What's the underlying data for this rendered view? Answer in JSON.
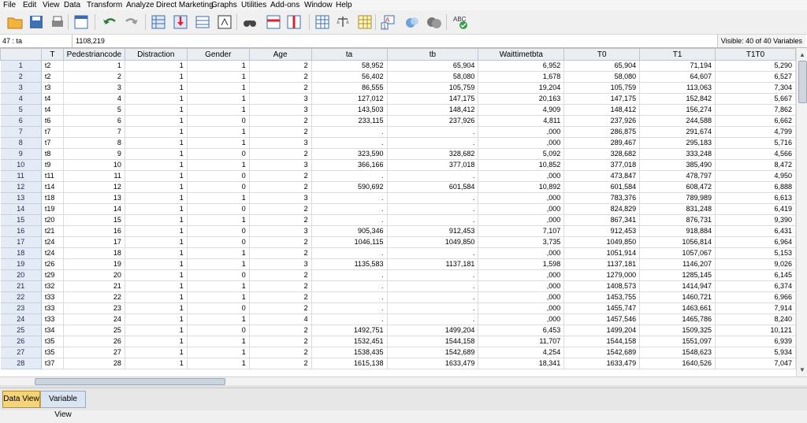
{
  "menu": [
    "File",
    "Edit",
    "View",
    "Data",
    "Transform",
    "Analyze",
    "Direct Marketing",
    "Graphs",
    "Utilities",
    "Add-ons",
    "Window",
    "Help"
  ],
  "toolbar_icons": [
    "open-folder-icon",
    "save-icon",
    "print-icon",
    "dialog-recall-icon",
    "undo-icon",
    "redo-icon",
    "goto-case-icon",
    "goto-variable-icon",
    "variables-icon",
    "run-descriptives-icon",
    "find-icon",
    "insert-cases-icon",
    "insert-variable-icon",
    "split-file-icon",
    "weight-cases-icon",
    "select-cases-icon",
    "value-labels-icon",
    "use-variable-sets-icon",
    "show-all-variables-icon",
    "spell-check-icon"
  ],
  "cell_editor": {
    "ref": "47 : ta",
    "value": "1108,219",
    "visible": "Visible: 40 of 40 Variables"
  },
  "columns": [
    "T",
    "Pedestriancode",
    "Distraction",
    "Gender",
    "Age",
    "ta",
    "tb",
    "Waittimetbta",
    "T0",
    "T1",
    "T1T0"
  ],
  "rows": [
    [
      "1",
      "t2",
      "1",
      "1",
      "1",
      "2",
      "58,952",
      "65,904",
      "6,952",
      "65,904",
      "71,194",
      "5,290"
    ],
    [
      "2",
      "t2",
      "2",
      "1",
      "1",
      "2",
      "56,402",
      "58,080",
      "1,678",
      "58,080",
      "64,607",
      "6,527"
    ],
    [
      "3",
      "t3",
      "3",
      "1",
      "1",
      "2",
      "86,555",
      "105,759",
      "19,204",
      "105,759",
      "113,063",
      "7,304"
    ],
    [
      "4",
      "t4",
      "4",
      "1",
      "1",
      "3",
      "127,012",
      "147,175",
      "20,163",
      "147,175",
      "152,842",
      "5,667"
    ],
    [
      "5",
      "t4",
      "5",
      "1",
      "1",
      "3",
      "143,503",
      "148,412",
      "4,909",
      "148,412",
      "156,274",
      "7,862"
    ],
    [
      "6",
      "t6",
      "6",
      "1",
      "0",
      "2",
      "233,115",
      "237,926",
      "4,811",
      "237,926",
      "244,588",
      "6,662"
    ],
    [
      "7",
      "t7",
      "7",
      "1",
      "1",
      "2",
      ".",
      ".",
      ",000",
      "286,875",
      "291,674",
      "4,799"
    ],
    [
      "8",
      "t7",
      "8",
      "1",
      "1",
      "3",
      ".",
      ".",
      ",000",
      "289,467",
      "295,183",
      "5,716"
    ],
    [
      "9",
      "t8",
      "9",
      "1",
      "0",
      "2",
      "323,590",
      "328,682",
      "5,092",
      "328,682",
      "333,248",
      "4,566"
    ],
    [
      "10",
      "t9",
      "10",
      "1",
      "1",
      "3",
      "366,166",
      "377,018",
      "10,852",
      "377,018",
      "385,490",
      "8,472"
    ],
    [
      "11",
      "t11",
      "11",
      "1",
      "0",
      "2",
      ".",
      ".",
      ",000",
      "473,847",
      "478,797",
      "4,950"
    ],
    [
      "12",
      "t14",
      "12",
      "1",
      "0",
      "2",
      "590,692",
      "601,584",
      "10,892",
      "601,584",
      "608,472",
      "6,888"
    ],
    [
      "13",
      "t18",
      "13",
      "1",
      "1",
      "3",
      ".",
      ".",
      ",000",
      "783,376",
      "789,989",
      "6,613"
    ],
    [
      "14",
      "t19",
      "14",
      "1",
      "0",
      "2",
      ".",
      ".",
      ",000",
      "824,829",
      "831,248",
      "6,419"
    ],
    [
      "15",
      "t20",
      "15",
      "1",
      "1",
      "2",
      ".",
      ".",
      ",000",
      "867,341",
      "876,731",
      "9,390"
    ],
    [
      "16",
      "t21",
      "16",
      "1",
      "0",
      "3",
      "905,346",
      "912,453",
      "7,107",
      "912,453",
      "918,884",
      "6,431"
    ],
    [
      "17",
      "t24",
      "17",
      "1",
      "0",
      "2",
      "1046,115",
      "1049,850",
      "3,735",
      "1049,850",
      "1056,814",
      "6,964"
    ],
    [
      "18",
      "t24",
      "18",
      "1",
      "1",
      "2",
      ".",
      ".",
      ",000",
      "1051,914",
      "1057,067",
      "5,153"
    ],
    [
      "19",
      "t26",
      "19",
      "1",
      "1",
      "3",
      "1135,583",
      "1137,181",
      "1,598",
      "1137,181",
      "1146,207",
      "9,026"
    ],
    [
      "20",
      "t29",
      "20",
      "1",
      "0",
      "2",
      ".",
      ".",
      ",000",
      "1279,000",
      "1285,145",
      "6,145"
    ],
    [
      "21",
      "t32",
      "21",
      "1",
      "1",
      "2",
      ".",
      ".",
      ",000",
      "1408,573",
      "1414,947",
      "6,374"
    ],
    [
      "22",
      "t33",
      "22",
      "1",
      "1",
      "2",
      ".",
      ".",
      ",000",
      "1453,755",
      "1460,721",
      "6,966"
    ],
    [
      "23",
      "t33",
      "23",
      "1",
      "0",
      "2",
      ".",
      ".",
      ",000",
      "1455,747",
      "1463,661",
      "7,914"
    ],
    [
      "24",
      "t33",
      "24",
      "1",
      "1",
      "4",
      ".",
      ".",
      ",000",
      "1457,546",
      "1465,786",
      "8,240"
    ],
    [
      "25",
      "t34",
      "25",
      "1",
      "0",
      "2",
      "1492,751",
      "1499,204",
      "6,453",
      "1499,204",
      "1509,325",
      "10,121"
    ],
    [
      "26",
      "t35",
      "26",
      "1",
      "1",
      "2",
      "1532,451",
      "1544,158",
      "11,707",
      "1544,158",
      "1551,097",
      "6,939"
    ],
    [
      "27",
      "t35",
      "27",
      "1",
      "1",
      "2",
      "1538,435",
      "1542,689",
      "4,254",
      "1542,689",
      "1548,623",
      "5,934"
    ],
    [
      "28",
      "t37",
      "28",
      "1",
      "1",
      "2",
      "1615,138",
      "1633,479",
      "18,341",
      "1633,479",
      "1640,526",
      "7,047"
    ]
  ],
  "tabs": {
    "data_view": "Data View",
    "variable_view": "Variable View",
    "active": "data_view"
  },
  "colors": {
    "active_tab": "#f5d478",
    "row_header": "#e4ebf5",
    "column_header": "#eaeef3"
  }
}
